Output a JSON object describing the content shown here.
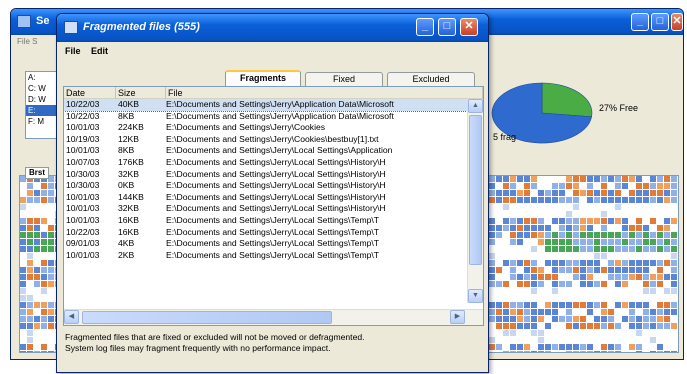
{
  "background_window": {
    "title": "Se",
    "menu": "File  S",
    "volumes": [
      "A:",
      "C: W",
      "D: W",
      "E:",
      "F: M"
    ],
    "selected_volume_index": 3,
    "free_label": "27% Free",
    "frag_label": "5 frag",
    "tab_label": "Brst",
    "buttons": {
      "minimize": "_",
      "maximize": "□",
      "close": "✕"
    }
  },
  "dialog": {
    "title": "Fragmented files (555)",
    "menu": {
      "file": "File",
      "edit": "Edit"
    },
    "buttons": {
      "minimize": "_",
      "maximize": "□",
      "close": "✕"
    },
    "tabs": [
      {
        "label": "Fragments",
        "active": true
      },
      {
        "label": "Fixed",
        "active": false
      },
      {
        "label": "Excluded",
        "active": false
      }
    ],
    "columns": {
      "date": "Date",
      "size": "Size",
      "file": "File"
    },
    "rows": [
      {
        "date": "10/22/03",
        "size": "40KB",
        "file": "E:\\Documents and Settings\\Jerry\\Application Data\\Microsoft"
      },
      {
        "date": "10/22/03",
        "size": "8KB",
        "file": "E:\\Documents and Settings\\Jerry\\Application Data\\Microsoft"
      },
      {
        "date": "10/01/03",
        "size": "224KB",
        "file": "E:\\Documents and Settings\\Jerry\\Cookies"
      },
      {
        "date": "10/19/03",
        "size": "12KB",
        "file": "E:\\Documents and Settings\\Jerry\\Cookies\\bestbuy[1].txt"
      },
      {
        "date": "10/01/03",
        "size": "8KB",
        "file": "E:\\Documents and Settings\\Jerry\\Local Settings\\Application"
      },
      {
        "date": "10/07/03",
        "size": "176KB",
        "file": "E:\\Documents and Settings\\Jerry\\Local Settings\\History\\H"
      },
      {
        "date": "10/30/03",
        "size": "32KB",
        "file": "E:\\Documents and Settings\\Jerry\\Local Settings\\History\\H"
      },
      {
        "date": "10/30/03",
        "size": "0KB",
        "file": "E:\\Documents and Settings\\Jerry\\Local Settings\\History\\H"
      },
      {
        "date": "10/01/03",
        "size": "144KB",
        "file": "E:\\Documents and Settings\\Jerry\\Local Settings\\History\\H"
      },
      {
        "date": "10/01/03",
        "size": "32KB",
        "file": "E:\\Documents and Settings\\Jerry\\Local Settings\\History\\H"
      },
      {
        "date": "10/01/03",
        "size": "16KB",
        "file": "E:\\Documents and Settings\\Jerry\\Local Settings\\Temp\\T"
      },
      {
        "date": "10/22/03",
        "size": "16KB",
        "file": "E:\\Documents and Settings\\Jerry\\Local Settings\\Temp\\T"
      },
      {
        "date": "09/01/03",
        "size": "4KB",
        "file": "E:\\Documents and Settings\\Jerry\\Local Settings\\Temp\\T"
      },
      {
        "date": "10/01/03",
        "size": "2KB",
        "file": "E:\\Documents and Settings\\Jerry\\Local Settings\\Temp\\T"
      }
    ],
    "footer_line1": "Fragmented files that are fixed or excluded will not be moved or defragmented.",
    "footer_line2": "System log files may fragment frequently with no performance impact."
  },
  "chart_data": {
    "type": "pie",
    "slices": [
      {
        "label": "Free",
        "value": 27,
        "color": "#4aac45"
      },
      {
        "label": "Used",
        "value": 73,
        "color": "#2f6bcf"
      }
    ]
  }
}
